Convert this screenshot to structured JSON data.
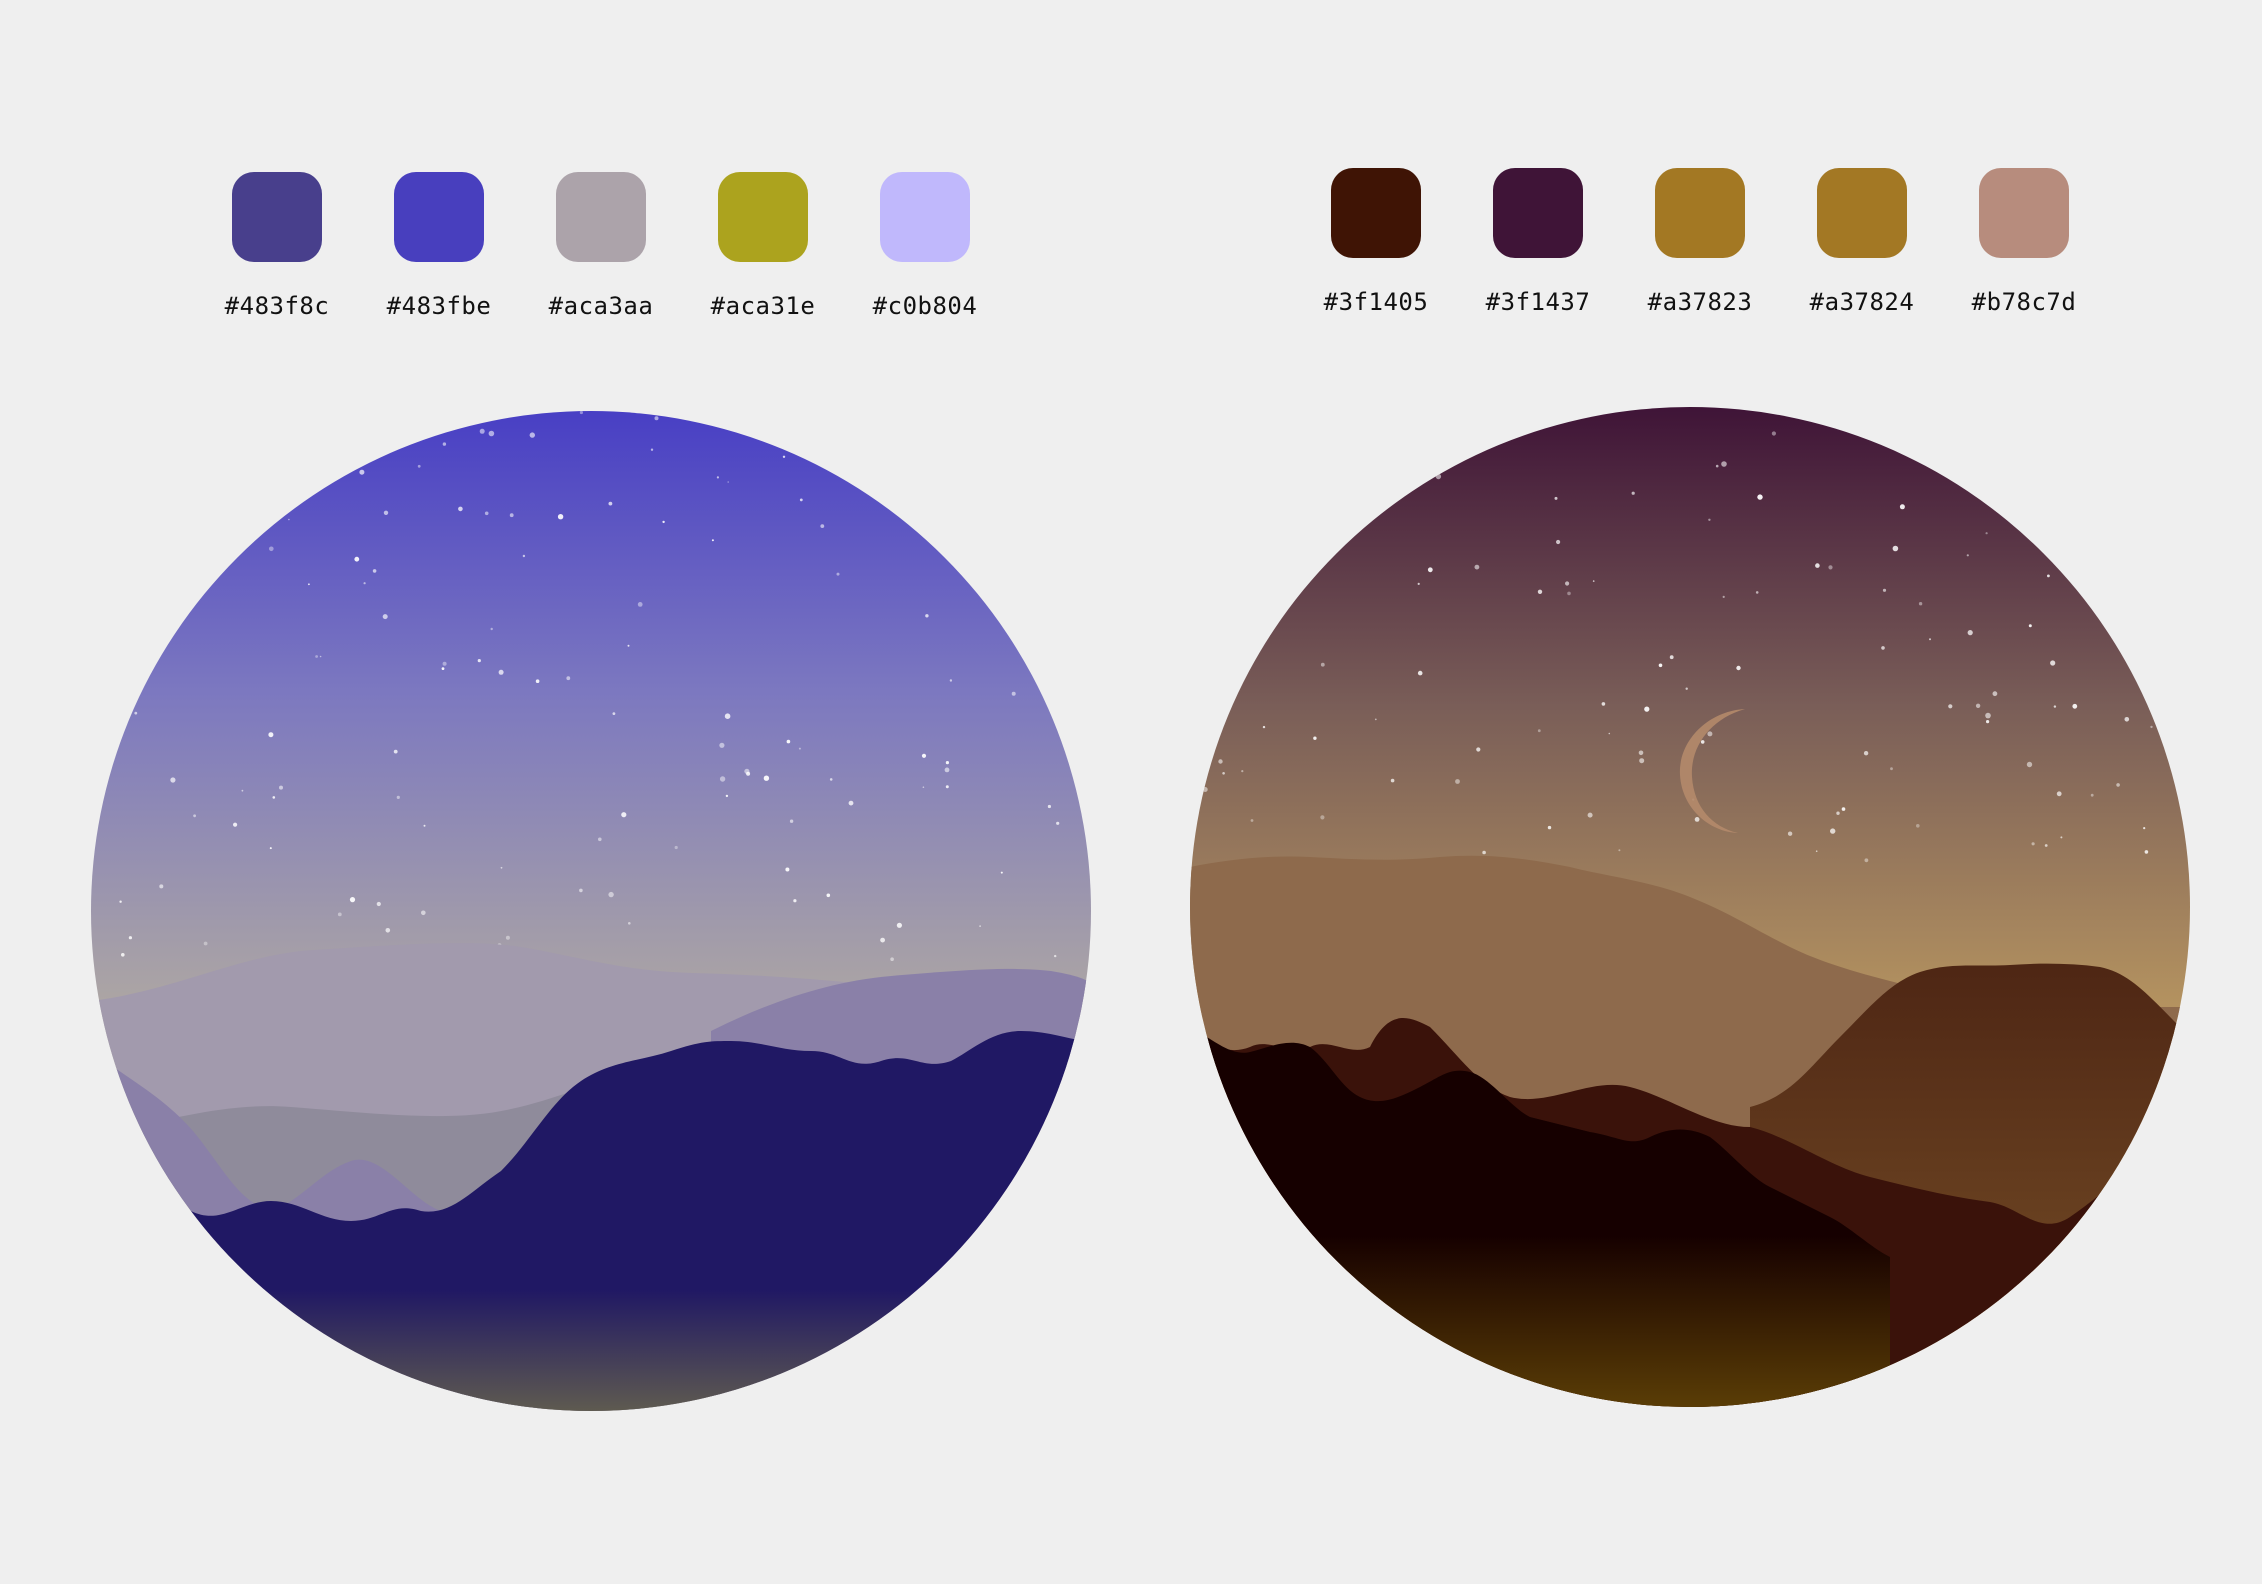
{
  "palettes": {
    "left": {
      "swatches": [
        {
          "label": "#483f8c",
          "color": "#483f8c"
        },
        {
          "label": "#483fbe",
          "color": "#483fbe"
        },
        {
          "label": "#aca3aa",
          "color": "#aca3aa"
        },
        {
          "label": "#aca31e",
          "color": "#aca31e"
        },
        {
          "label": "#c0b804",
          "color": "#c0b8fc"
        }
      ]
    },
    "right": {
      "swatches": [
        {
          "label": "#3f1405",
          "color": "#3f1405"
        },
        {
          "label": "#3f1437",
          "color": "#3f1437"
        },
        {
          "label": "#a37823",
          "color": "#a37823"
        },
        {
          "label": "#a37824",
          "color": "#a37824"
        },
        {
          "label": "#b78c7d",
          "color": "#b78c7d"
        }
      ]
    }
  },
  "scenes": {
    "left": {
      "theme": "night mountains, blue-violet sky",
      "sky_top": "#483fc4",
      "sky_mid": "#7c78c0",
      "sky_horizon": "#c0b898",
      "far_hills": "#a29aad",
      "mid_hills": "#8a80a8",
      "near_hills": "#201864",
      "ground_bottom": "#5e5a50"
    },
    "right": {
      "theme": "dusk desert mountains with crescent moon",
      "sky_top": "#3f1437",
      "sky_mid": "#7a5e58",
      "sky_horizon": "#b89660",
      "far_hills": "#8e6a4c",
      "mid_hills": "#5e3820",
      "near_hills": "#160000",
      "ground_bottom": "#5a3d06"
    }
  }
}
